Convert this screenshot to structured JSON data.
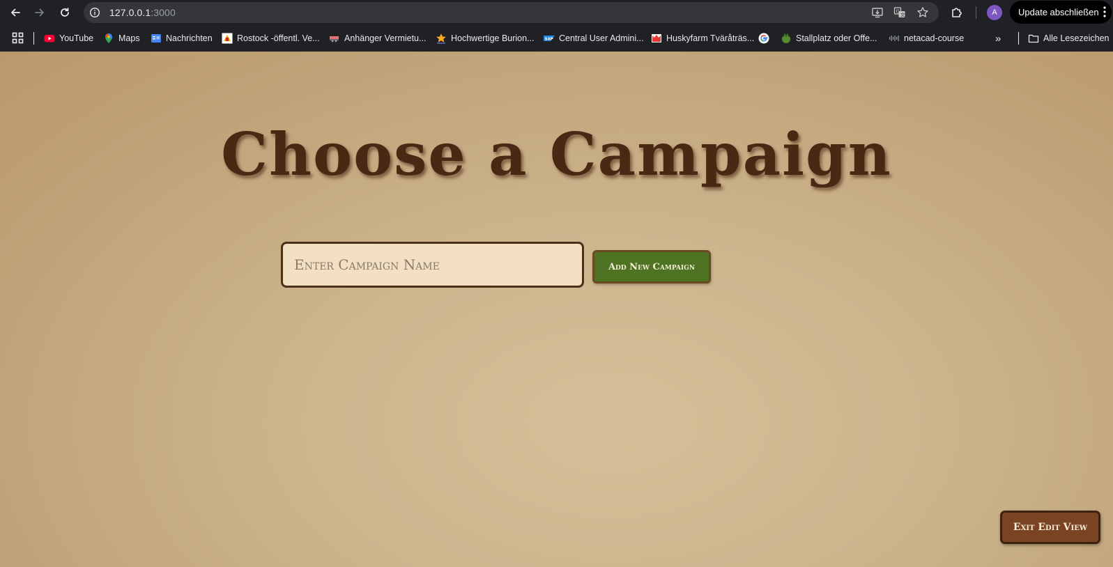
{
  "browser": {
    "url_host": "127.0.0.1",
    "url_port": ":3000",
    "profile_initial": "A",
    "update_label": "Update abschließen"
  },
  "bookmarks": {
    "items": [
      {
        "label": "YouTube",
        "icon": "youtube-icon",
        "color": "#ff0033"
      },
      {
        "label": "Maps",
        "icon": "maps-pin-icon",
        "color": "#34a853"
      },
      {
        "label": "Nachrichten",
        "icon": "google-news-icon",
        "color": "#4285f4"
      },
      {
        "label": "Rostock -öffentl. Ve...",
        "icon": "rostock-transit-icon",
        "color": "#ffffff"
      },
      {
        "label": "Anhänger Vermietu...",
        "icon": "trailer-rental-icon",
        "color": "#e57373"
      },
      {
        "label": "Hochwertige Burion...",
        "icon": "star-logo-icon",
        "color": "#f9a825"
      },
      {
        "label": "Central User Admini...",
        "icon": "sap-icon",
        "color": "#1e88e5"
      },
      {
        "label": "Huskyfarm Tväråträs...",
        "icon": "huskyfarm-icon",
        "color": "#e53935"
      },
      {
        "label": "",
        "icon": "google-icon",
        "color": "#ffffff"
      },
      {
        "label": "Stallplatz oder Offe...",
        "icon": "stallplatz-icon",
        "color": "#558b2f"
      },
      {
        "label": "netacad-course",
        "icon": "cisco-icon",
        "color": "#9aa0a6"
      }
    ],
    "all_bookmarks_label": "Alle Lesezeichen"
  },
  "page": {
    "title": "Choose a Campaign",
    "campaign_input_placeholder": "Enter Campaign Name",
    "add_button_label": "Add New Campaign",
    "exit_button_label": "Exit Edit View"
  },
  "colors": {
    "parchment": "#cdb58e",
    "title_brown": "#4a2914",
    "add_green": "#4d7323",
    "exit_brown": "#7a4322"
  }
}
